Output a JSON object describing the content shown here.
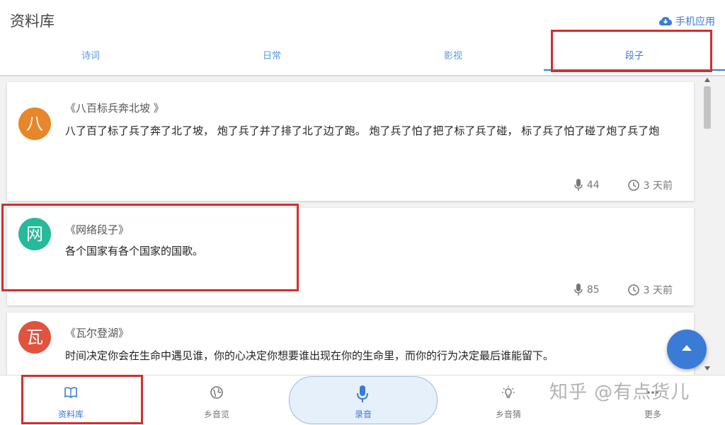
{
  "header": {
    "title": "资料库",
    "app_link": "手机应用"
  },
  "tabs": [
    {
      "label": "诗词",
      "active": false
    },
    {
      "label": "日常",
      "active": false
    },
    {
      "label": "影视",
      "active": false
    },
    {
      "label": "段子",
      "active": true
    }
  ],
  "cards": [
    {
      "avatar": "八",
      "avatar_color": "#e8862a",
      "title": "《八百标兵奔北坡 》",
      "body": "八了百了标了兵了奔了北了坡，  炮了兵了并了排了北了边了跑。  炮了兵了怕了把了标了兵了碰，  标了兵了怕了碰了炮了兵了炮",
      "plays": "44",
      "time": "3 天前"
    },
    {
      "avatar": "网",
      "avatar_color": "#26b99a",
      "title": "《网络段子》",
      "body": "各个国家有各个国家的国歌。",
      "plays": "85",
      "time": "3 天前"
    },
    {
      "avatar": "瓦",
      "avatar_color": "#e0533f",
      "title": "《瓦尔登湖》",
      "body": "时间决定你会在生命中遇见谁，你的心决定你想要谁出现在你的生命里，而你的行为决定最后谁能留下。",
      "plays": "",
      "time": ""
    }
  ],
  "nav": [
    {
      "label": "资料库",
      "icon": "book-icon",
      "active": true
    },
    {
      "label": "乡音览",
      "icon": "globe-icon",
      "active": false
    },
    {
      "label": "录音",
      "icon": "microphone-icon",
      "active": false
    },
    {
      "label": "乡音猜",
      "icon": "lightbulb-icon",
      "active": false
    },
    {
      "label": "更多",
      "icon": "more-icon",
      "active": false
    }
  ],
  "watermark": "知乎 @有点货儿",
  "colors": {
    "accent": "#3a7bd5",
    "highlight": "#d62d2d"
  }
}
